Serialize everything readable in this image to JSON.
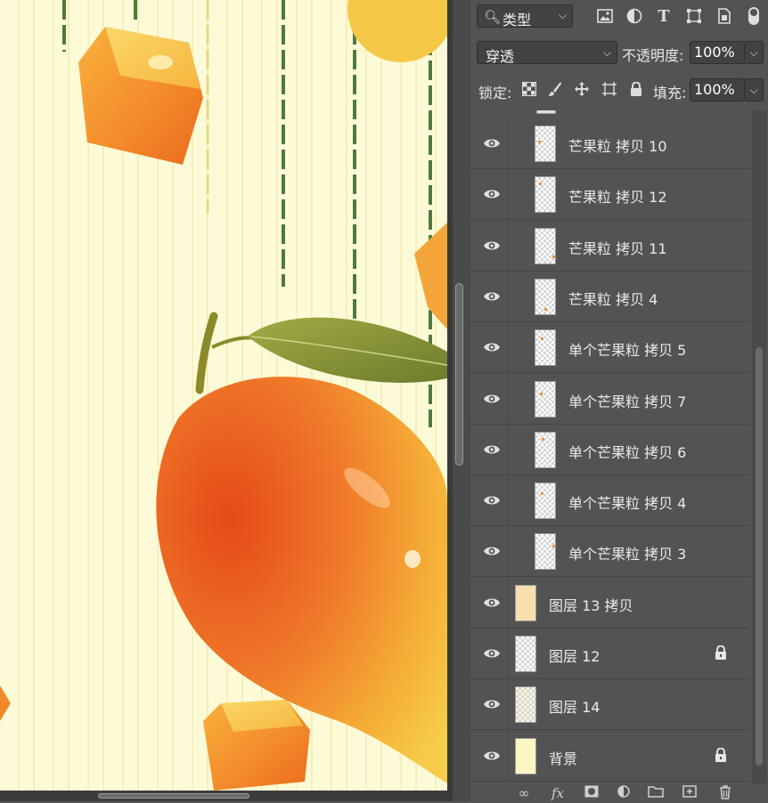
{
  "filter_bar": {
    "filter_type": "类型"
  },
  "blend": {
    "mode": "穿透",
    "opacity_label": "不透明度:",
    "opacity_value": "100%"
  },
  "lock_bar": {
    "lock_label": "锁定:",
    "fill_label": "填充:",
    "fill_value": "100%"
  },
  "layers": [
    {
      "name": "芒果粒 拷贝 10",
      "indent": true,
      "locked": false
    },
    {
      "name": "芒果粒 拷贝 12",
      "indent": true,
      "locked": false
    },
    {
      "name": "芒果粒 拷贝 11",
      "indent": true,
      "locked": false
    },
    {
      "name": "芒果粒 拷贝 4",
      "indent": true,
      "locked": false
    },
    {
      "name": "单个芒果粒 拷贝 5",
      "indent": true,
      "locked": false
    },
    {
      "name": "单个芒果粒 拷贝 7",
      "indent": true,
      "locked": false
    },
    {
      "name": "单个芒果粒 拷贝 6",
      "indent": true,
      "locked": false
    },
    {
      "name": "单个芒果粒 拷贝 4",
      "indent": true,
      "locked": false
    },
    {
      "name": "单个芒果粒 拷贝 3",
      "indent": true,
      "locked": false
    },
    {
      "name": "图层 13 拷贝",
      "indent": false,
      "locked": false
    },
    {
      "name": "图层 12",
      "indent": false,
      "locked": true
    },
    {
      "name": "图层 14",
      "indent": false,
      "locked": false
    },
    {
      "name": "背景",
      "indent": false,
      "locked": true
    }
  ],
  "colors": {
    "panel_bg": "#535353",
    "canvas_bg": "#fdfbd7",
    "mango_orange": "#f07a2a",
    "leaf_green": "#8a9a3a"
  }
}
